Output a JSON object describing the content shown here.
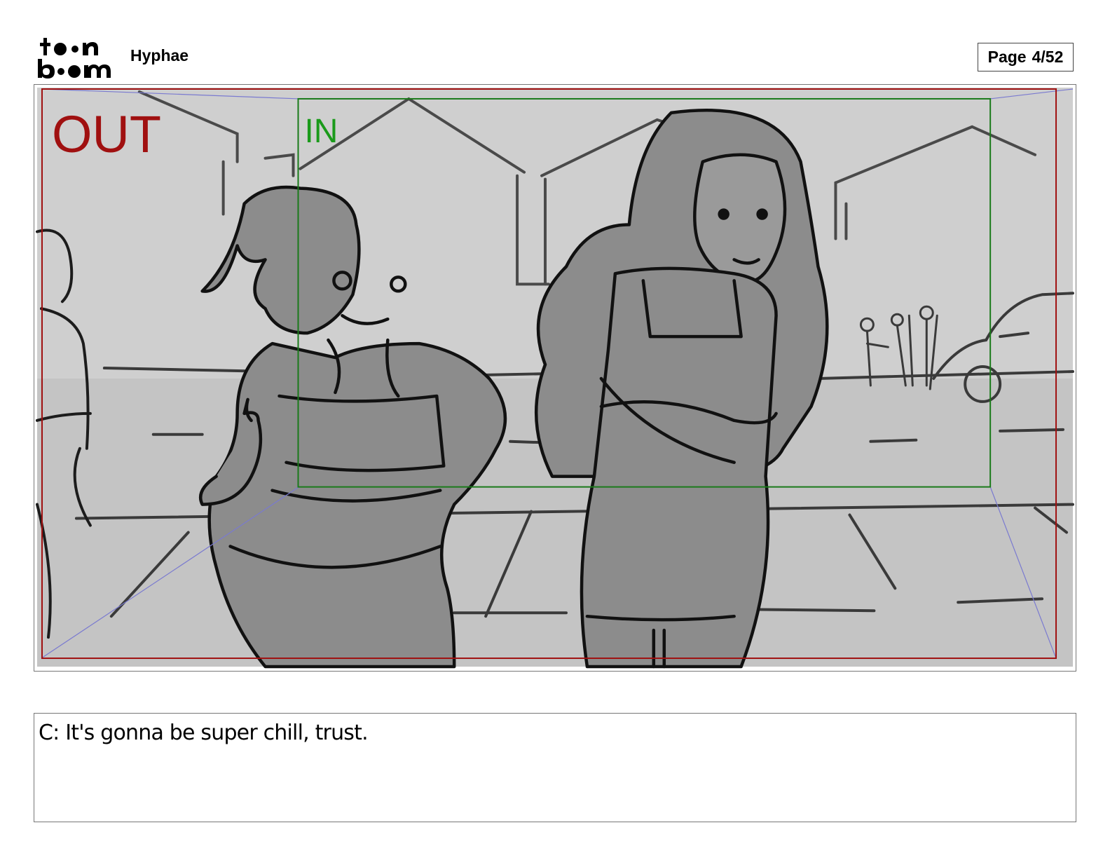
{
  "header": {
    "logo_top": "toon",
    "logo_bottom": "boom",
    "project_title": "Hyphae",
    "page_label": "Page",
    "page_number": "4/52"
  },
  "panel": {
    "out_label": "OUT",
    "in_label": "IN",
    "colors": {
      "out_frame": "#a01010",
      "in_frame": "#1a7a1a",
      "perspective": "#7a7ad0",
      "sketch_bg": "#cdcdcd",
      "figure_fill": "#8a8a8a"
    }
  },
  "caption": {
    "text": "C: It's gonna be super chill, trust."
  }
}
